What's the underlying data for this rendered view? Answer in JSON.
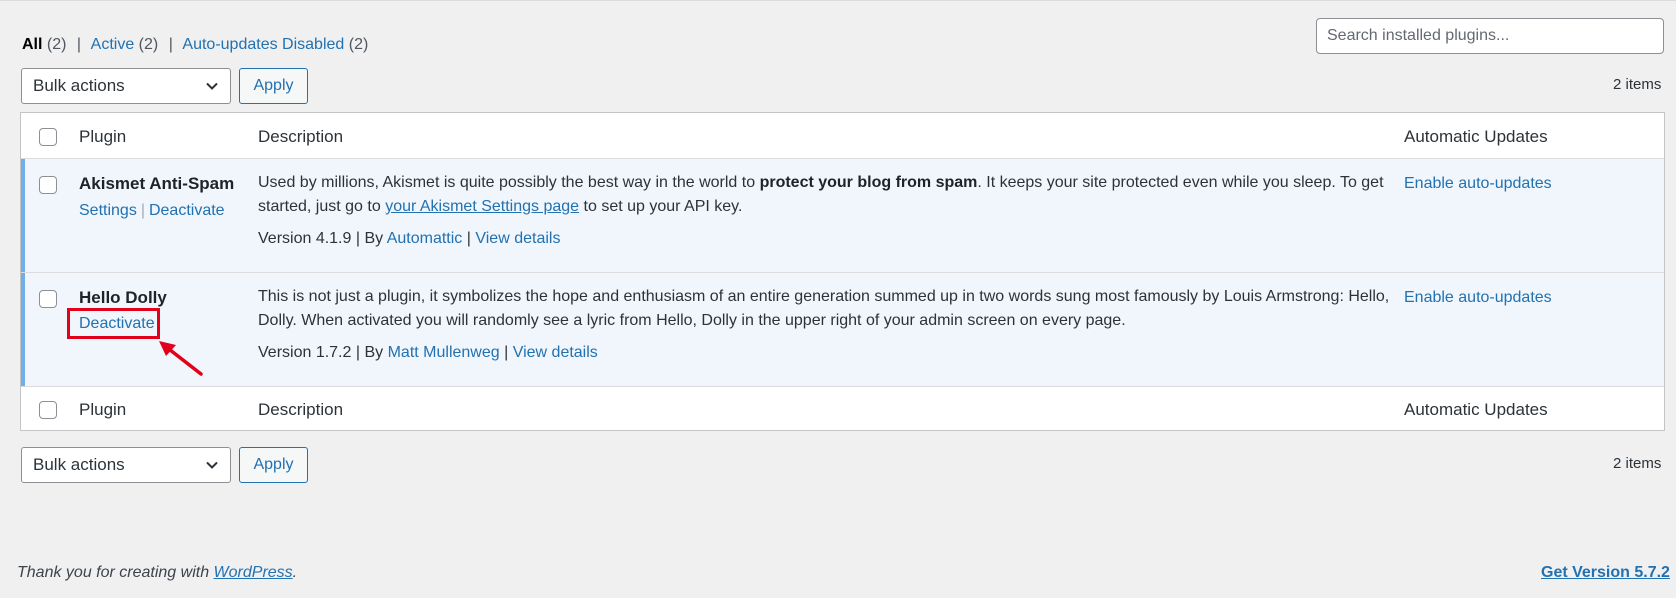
{
  "filters": {
    "all_label": "All",
    "all_count": "(2)",
    "active_label": "Active",
    "active_count": "(2)",
    "auto_disabled_label": "Auto-updates Disabled",
    "auto_disabled_count": "(2)",
    "separator": "|"
  },
  "search": {
    "placeholder": "Search installed plugins..."
  },
  "bulk_top": {
    "selected": "Bulk actions",
    "apply_label": "Apply",
    "count": "2 items"
  },
  "bulk_bottom": {
    "selected": "Bulk actions",
    "apply_label": "Apply",
    "count": "2 items"
  },
  "table": {
    "columns": {
      "plugin": "Plugin",
      "description": "Description",
      "auto_updates": "Automatic Updates"
    },
    "plugins": [
      {
        "name": "Akismet Anti-Spam",
        "action_settings": "Settings",
        "action_deactivate": "Deactivate",
        "action_sep": "|",
        "desc_part1": "Used by millions, Akismet is quite possibly the best way in the world to ",
        "desc_bold": "protect your blog from spam",
        "desc_part2": ". It keeps your site protected even while you sleep. To get started, just go to ",
        "desc_link": "your Akismet Settings page",
        "desc_part3": " to set up your API key.",
        "version": "Version 4.1.9",
        "by": "By",
        "author": "Automattic",
        "view_details": "View details",
        "meta_sep": "|",
        "auto_update_link": "Enable auto-updates"
      },
      {
        "name": "Hello Dolly",
        "action_deactivate": "Deactivate",
        "description": "This is not just a plugin, it symbolizes the hope and enthusiasm of an entire generation summed up in two words sung most famously by Louis Armstrong: Hello, Dolly. When activated you will randomly see a lyric from Hello, Dolly in the upper right of your admin screen on every page.",
        "version": "Version 1.7.2",
        "by": "By",
        "author": "Matt Mullenweg",
        "view_details": "View details",
        "meta_sep": "|",
        "auto_update_link": "Enable auto-updates"
      }
    ]
  },
  "footer": {
    "thanks_prefix": "Thank you for creating with ",
    "wordpress_link": "WordPress",
    "thanks_suffix": ".",
    "version_link": "Get Version 5.7.2"
  },
  "colors": {
    "link": "#2271b1",
    "active_row_bg": "#f0f6fc",
    "active_row_border": "#72aee6",
    "annotation_red": "#e3001b"
  }
}
